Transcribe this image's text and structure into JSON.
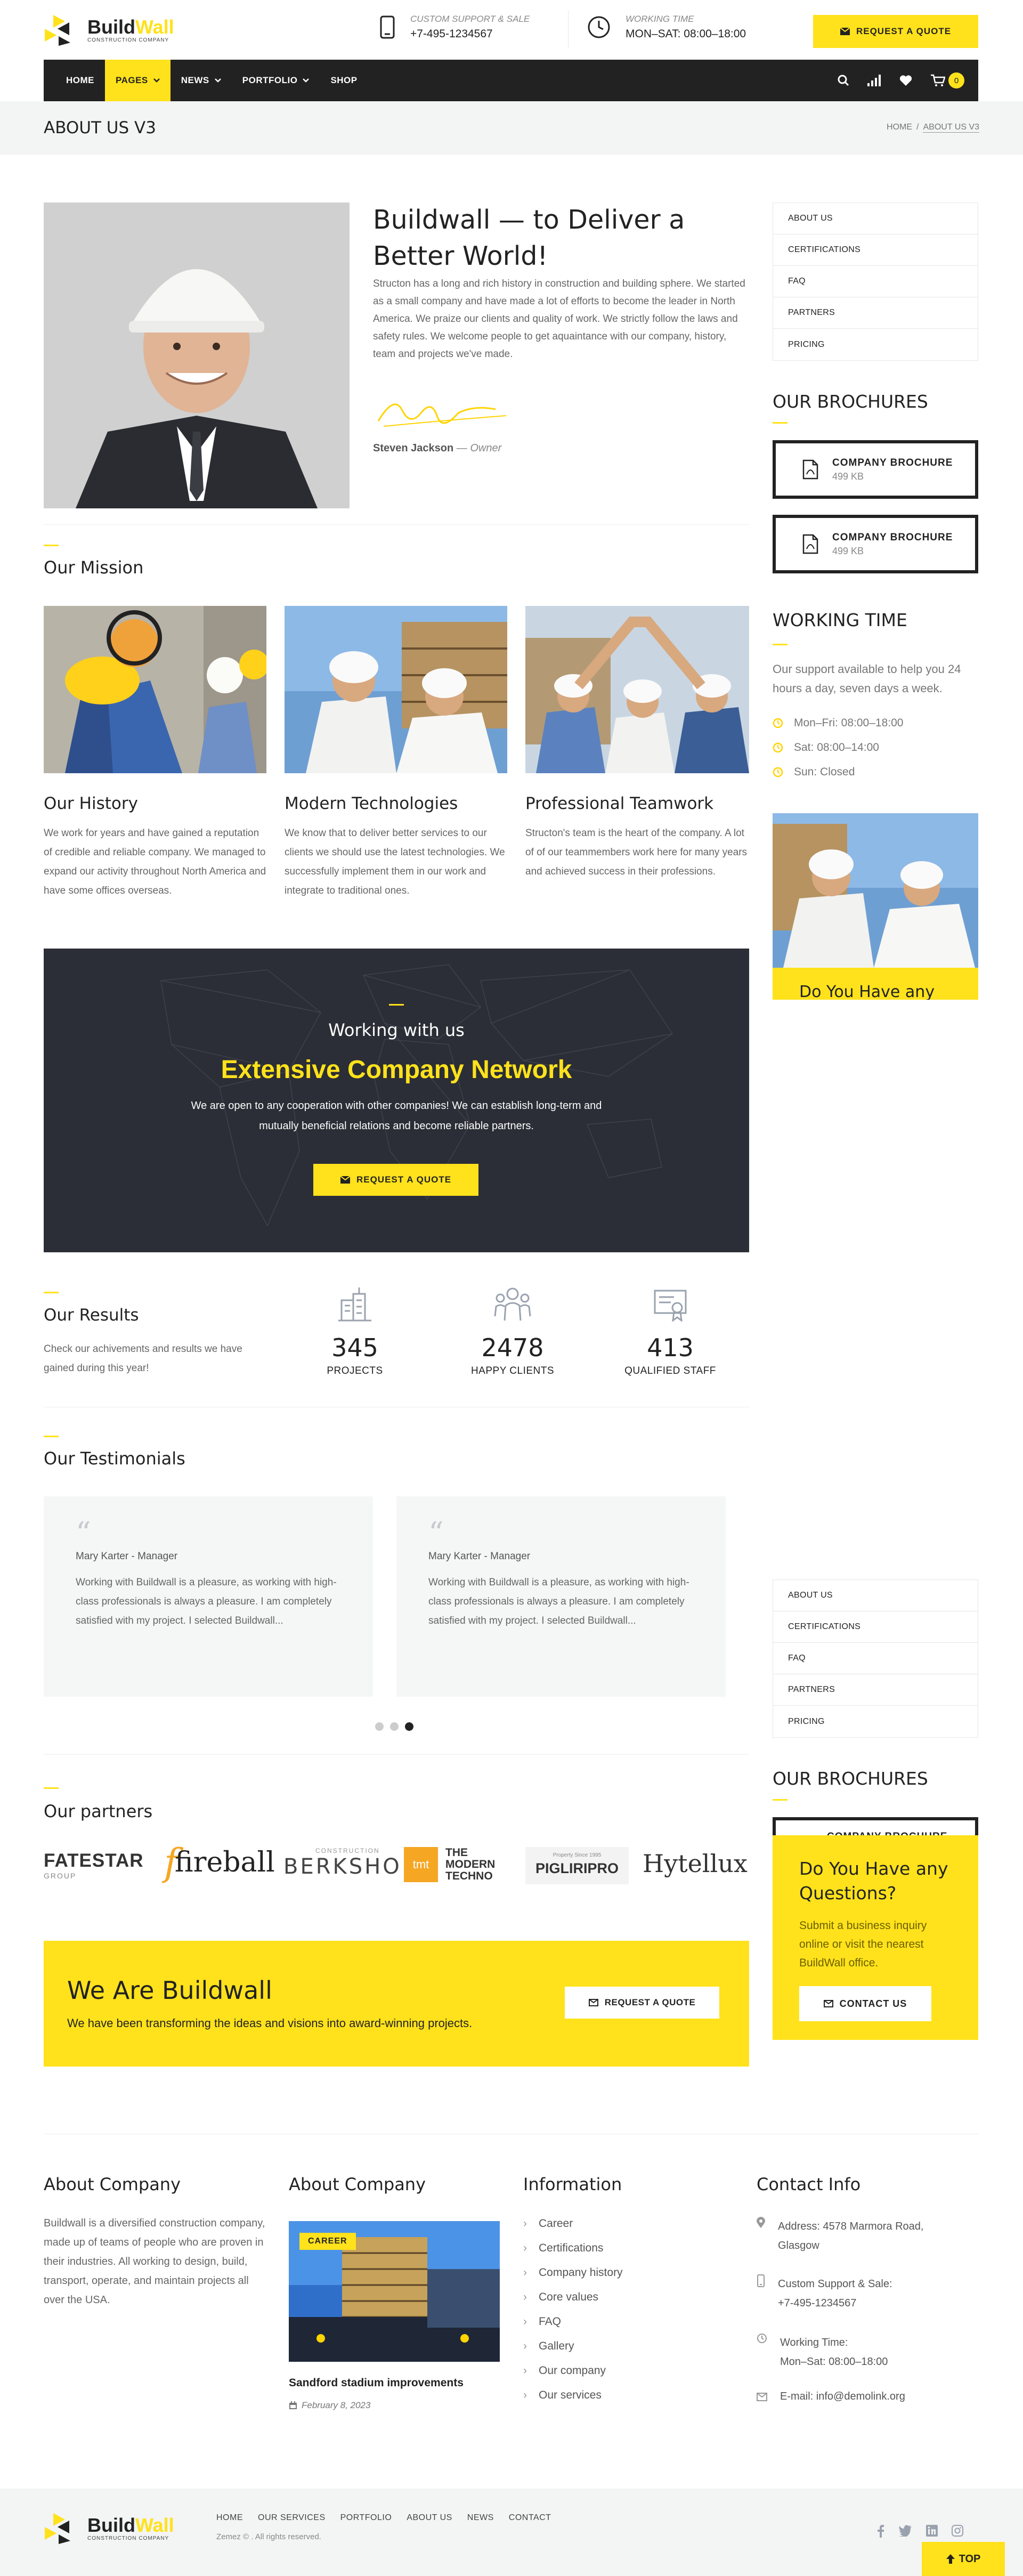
{
  "header": {
    "logo_build": "Build",
    "logo_wall": "Wall",
    "logo_sub": "CONSTRUCTION COMPANY",
    "support_label": "CUSTOM SUPPORT & SALE",
    "support_phone": "+7-495-1234567",
    "time_label": "WORKING TIME",
    "time_value": "MON–SAT: 08:00–18:00",
    "quote_label": "REQUEST A QUOTE"
  },
  "nav": {
    "items": [
      "HOME",
      "PAGES",
      "NEWS",
      "PORTFOLIO",
      "SHOP"
    ],
    "cart_count": "0"
  },
  "page_header": {
    "title": "ABOUT US V3",
    "crumb_home": "HOME",
    "crumb_sep": "/",
    "crumb_current": "ABOUT US V3"
  },
  "intro": {
    "title_l1": "Buildwall — to Deliver a",
    "title_l2": "Better World!",
    "text": "Structon has a long and rich history in construction and building sphere. We started as a small company and have made a lot of efforts to become the leader in North America. We praize our clients and quality of work. We strictly follow the laws and safety rules. We welcome people to get aquaintance with our company, history, team and projects we've made.",
    "author": "Steven Jackson",
    "author_role": "— Owner"
  },
  "mission": {
    "title": "Our Mission",
    "cards": [
      {
        "title": "Our History",
        "text": "We work for years and have gained a reputation of credible and reliable company. We managed to expand our activity throughout North America and have some offices overseas."
      },
      {
        "title": "Modern Technologies",
        "text": "We know that to deliver better services to our clients we should use the latest technologies. We successfully implement them in our work and integrate to traditional ones."
      },
      {
        "title": "Professional Teamwork",
        "text": "Structon's team is the heart of the company. A lot of of our teammembers work here for many years and achieved success in their professions."
      }
    ]
  },
  "network": {
    "pre": "Working with us",
    "title": "Extensive Company Network",
    "text_l1": "We are open to any cooperation with other companies! We can establish long-term and",
    "text_l2": "mutually beneficial relations and become reliable partners.",
    "button": "REQUEST A QUOTE"
  },
  "results": {
    "title": "Our Results",
    "text": "Check our achivements and results we have gained during this year!",
    "stats": [
      {
        "value": "345",
        "label": "PROJECTS",
        "icon": "buildings-icon"
      },
      {
        "value": "2478",
        "label": "HAPPY CLIENTS",
        "icon": "people-icon"
      },
      {
        "value": "413",
        "label": "QUALIFIED STAFF",
        "icon": "certificate-icon"
      }
    ]
  },
  "testimonials": {
    "title": "Our Testimonials",
    "items": [
      {
        "author": "Mary Karter - Manager",
        "text": "Working with Buildwall is a pleasure, as working with high-class professionals is always a pleasure. I am completely satisfied with my project. I selected Buildwall..."
      },
      {
        "author": "Mary Karter - Manager",
        "text": "Working with Buildwall is a pleasure, as working with high-class professionals is always a pleasure. I am completely satisfied with my project. I selected Buildwall..."
      }
    ]
  },
  "partners": {
    "title": "Our partners",
    "logos": [
      {
        "name": "FATESTAR",
        "sub": "GROUP"
      },
      {
        "name": "fireball"
      },
      {
        "name": "BERKSHO",
        "sub": "CONSTRUCTION"
      },
      {
        "name": "THE MODERN TECHNO",
        "badge": "tmt"
      },
      {
        "name": "PIGLIRIPRO",
        "sub": "Property Since 1995"
      },
      {
        "name": "Hytellux"
      }
    ]
  },
  "cta": {
    "title": "We Are Buildwall",
    "text": "We have been transforming the ideas and visions into award-winning projects.",
    "button": "REQUEST A QUOTE"
  },
  "sidebar": {
    "menu": [
      "ABOUT US",
      "CERTIFICATIONS",
      "FAQ",
      "PARTNERS",
      "PRICING"
    ],
    "brochures_title": "OUR BROCHURES",
    "brochures": [
      {
        "title": "COMPANY BROCHURE",
        "size": "499 KB"
      },
      {
        "title": "COMPANY BROCHURE",
        "size": "499 KB"
      }
    ],
    "working_title": "WORKING TIME",
    "working_text": "Our support available to help you 24 hours a day, seven days a week.",
    "hours": [
      "Mon–Fri: 08:00–18:00",
      "Sat: 08:00–14:00",
      "Sun: Closed"
    ],
    "promo_peek": "Do You Have any",
    "promo_title_l1": "Do You Have any",
    "promo_title_l2": "Questions?",
    "promo_text": "Submit a business inquiry online or visit the nearest BuildWall office.",
    "promo_button": "CONTACT US",
    "brochure_peek": "COMPANY BROCHURE"
  },
  "footer": {
    "about_title": "About Company",
    "about_text": "Buildwall is a diversified construction company, made up of teams of people who are proven in their industries. All working to design, build, transport, operate, and maintain projects all over the USA.",
    "news_title": "About Company",
    "news_badge": "CAREER",
    "news_headline": "Sandford stadium improvements",
    "news_date": "February 8, 2023",
    "info_title": "Information",
    "info_links": [
      "Career",
      "Certifications",
      "Company history",
      "Core values",
      "FAQ",
      "Gallery",
      "Our company",
      "Our services"
    ],
    "contact_title": "Contact Info",
    "address_l1": "Address: 4578 Marmora Road,",
    "address_l2": "Glasgow",
    "support_l1": "Custom Support & Sale:",
    "support_l2": "+7-495-1234567",
    "time_l1": "Working Time:",
    "time_l2": "Mon–Sat: 08:00–18:00",
    "email": "E-mail: info@demolink.org"
  },
  "bottom": {
    "links": [
      "HOME",
      "OUR SERVICES",
      "PORTFOLIO",
      "ABOUT US",
      "NEWS",
      "CONTACT"
    ],
    "copyright": "Zemez © . All rights reserved.",
    "top": "TOP"
  },
  "colors": {
    "accent": "#ffe21b",
    "dark": "#222222",
    "dark_band": "#2b2e36",
    "gray_bg": "#f3f4f4"
  }
}
